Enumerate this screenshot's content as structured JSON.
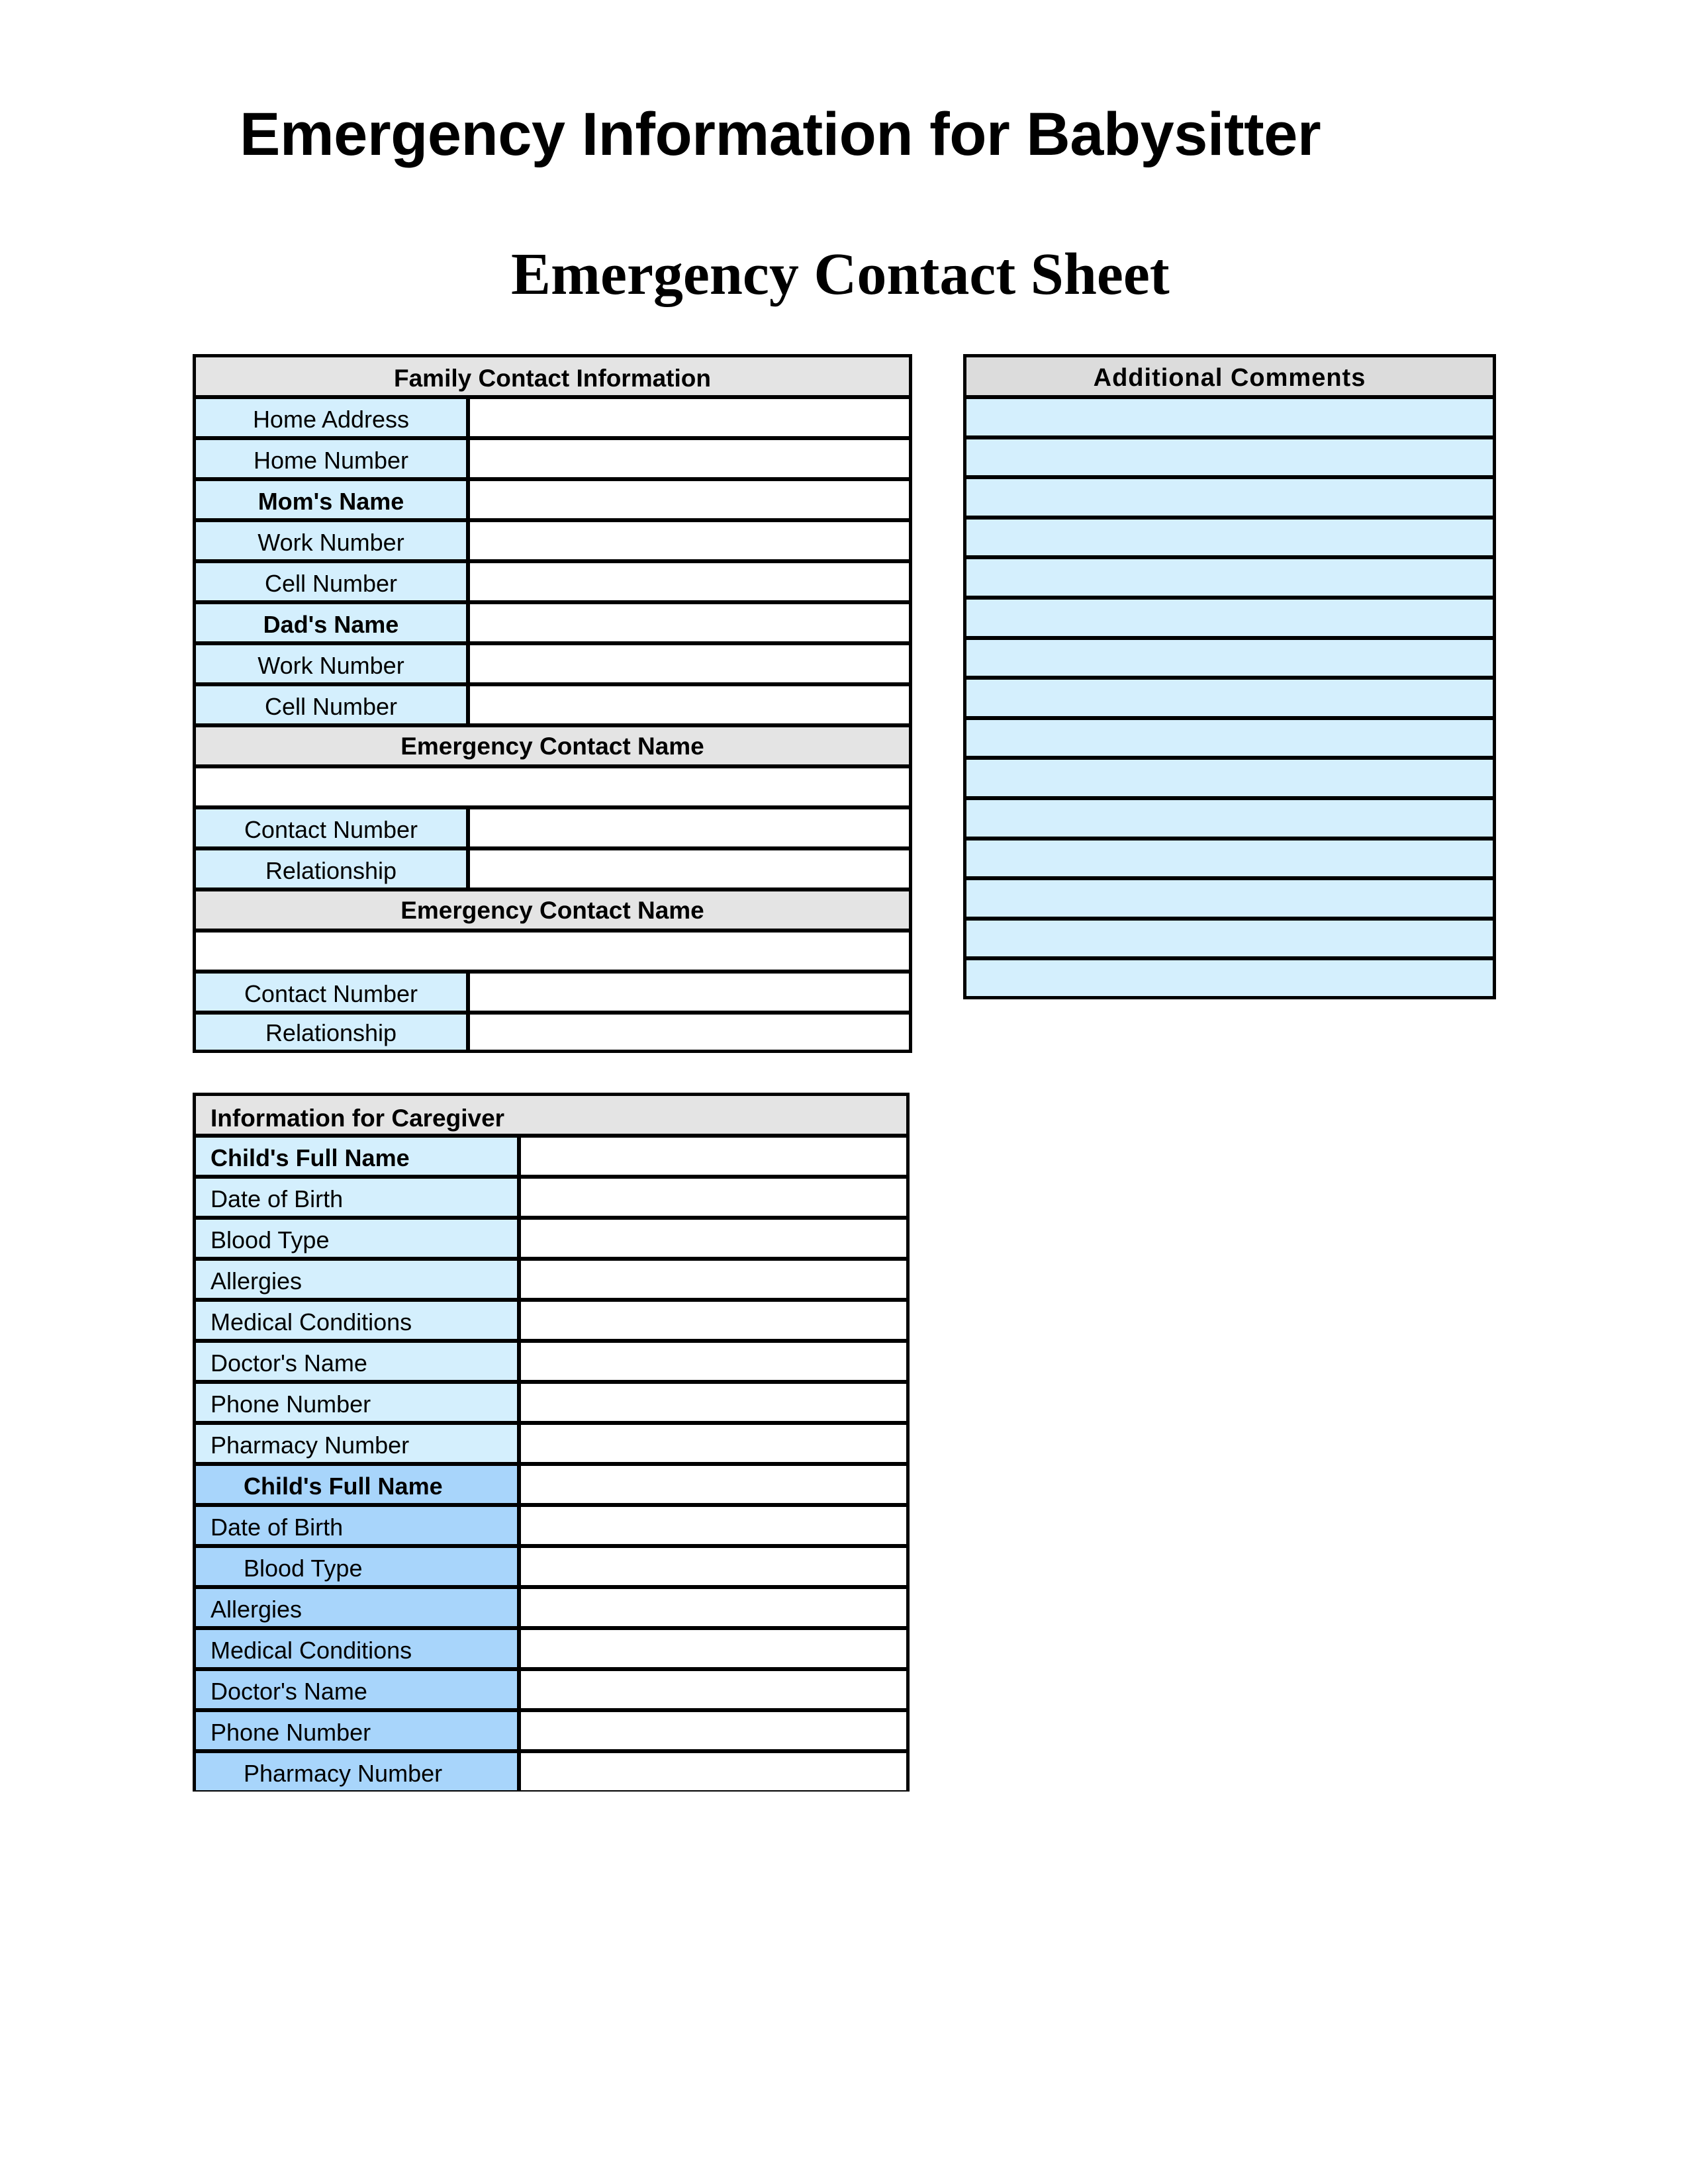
{
  "title": "Emergency Information for Babysitter",
  "subtitle": "Emergency Contact Sheet",
  "colors": {
    "label_light_blue": "#d4effd",
    "label_dark_blue": "#a8d5fb",
    "header_gray": "#e4e4e4",
    "border": "#000000"
  },
  "family": {
    "header": "Family Contact Information",
    "rows": [
      {
        "label": "Home Address",
        "value": ""
      },
      {
        "label": "Home Number",
        "value": ""
      },
      {
        "label": "Mom's Name",
        "value": ""
      },
      {
        "label": "Work Number",
        "value": ""
      },
      {
        "label": "Cell Number",
        "value": ""
      },
      {
        "label": "Dad's Name",
        "value": ""
      },
      {
        "label": "Work Number",
        "value": ""
      },
      {
        "label": "Cell Number",
        "value": ""
      }
    ],
    "emergency_contacts": [
      {
        "header": "Emergency Contact Name",
        "name_value": "",
        "rows": [
          {
            "label": "Contact Number",
            "value": ""
          },
          {
            "label": "Relationship",
            "value": ""
          }
        ]
      },
      {
        "header": "Emergency Contact Name",
        "name_value": "",
        "rows": [
          {
            "label": "Contact Number",
            "value": ""
          },
          {
            "label": "Relationship",
            "value": ""
          }
        ]
      }
    ]
  },
  "comments": {
    "header": "Additional Comments",
    "lines": [
      "",
      "",
      "",
      "",
      "",
      "",
      "",
      "",
      "",
      "",
      "",
      "",
      "",
      "",
      ""
    ]
  },
  "caregiver": {
    "header": "Information for Caregiver",
    "children": [
      {
        "rows": [
          {
            "label": "Child's Full Name",
            "value": ""
          },
          {
            "label": "Date of Birth",
            "value": ""
          },
          {
            "label": "Blood Type",
            "value": ""
          },
          {
            "label": "Allergies",
            "value": ""
          },
          {
            "label": "Medical Conditions",
            "value": ""
          },
          {
            "label": "Doctor's Name",
            "value": ""
          },
          {
            "label": "Phone Number",
            "value": ""
          },
          {
            "label": "Pharmacy Number",
            "value": ""
          }
        ]
      },
      {
        "rows": [
          {
            "label": "Child's Full Name",
            "value": ""
          },
          {
            "label": "Date of Birth",
            "value": ""
          },
          {
            "label": "Blood Type",
            "value": ""
          },
          {
            "label": "Allergies",
            "value": ""
          },
          {
            "label": "Medical Conditions",
            "value": ""
          },
          {
            "label": "Doctor's Name",
            "value": ""
          },
          {
            "label": "Phone Number",
            "value": ""
          },
          {
            "label": "Pharmacy Number",
            "value": ""
          }
        ]
      }
    ]
  }
}
